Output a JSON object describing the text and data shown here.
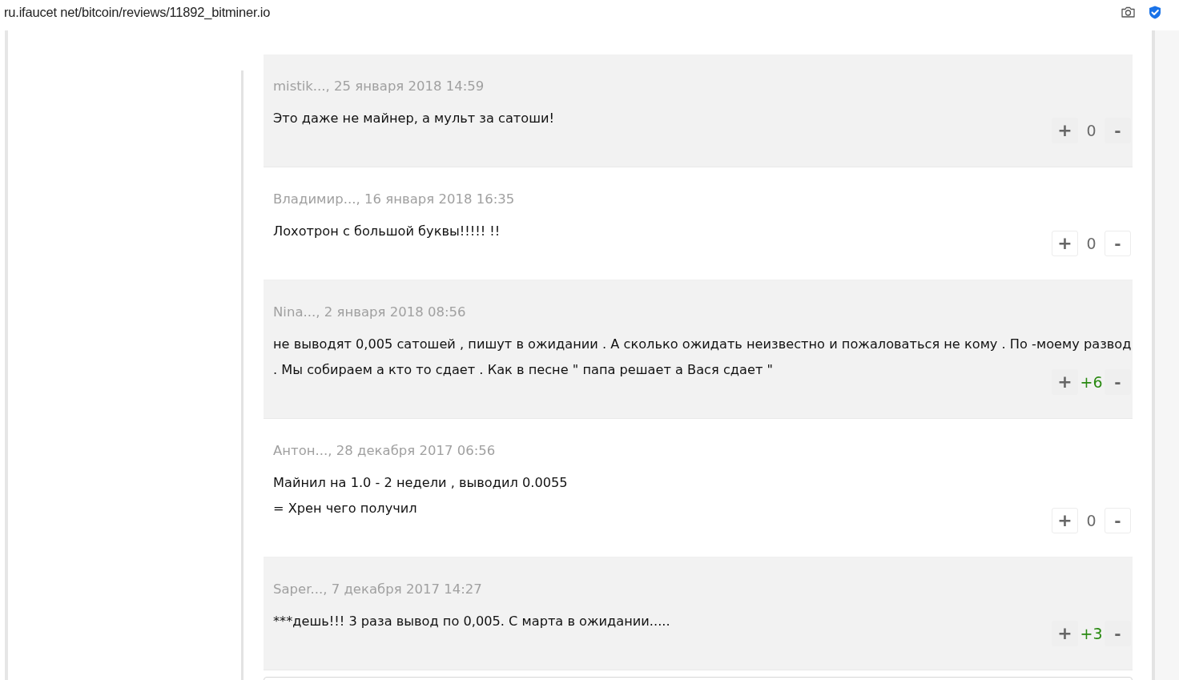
{
  "address_bar": {
    "url": "ru.ifaucet net/bitcoin/reviews/11892_bitminer.io"
  },
  "comments": [
    {
      "meta": "mistik..., 25 января 2018 14:59",
      "lines": [
        "Это даже не майнер, а мульт за сатоши!"
      ],
      "shaded": true,
      "votes": {
        "up": "+",
        "score": "0",
        "down": "-",
        "color": "#6a6a6a"
      }
    },
    {
      "meta": "Владимир..., 16 января 2018 16:35",
      "lines": [
        "Лохотрон с большой буквы!!!!! !!"
      ],
      "shaded": false,
      "votes": {
        "up": "+",
        "score": "0",
        "down": "-",
        "color": "#6a6a6a"
      }
    },
    {
      "meta": "Nina..., 2 января 2018 08:56",
      "lines": [
        "не выводят 0,005 сатошей , пишут в ожидании . А сколько ожидать неизвестно и пожаловаться не кому . По -моему развод",
        ". Мы собираем а кто то сдает . Как в песне \" папа решает а Вася сдает \""
      ],
      "shaded": true,
      "votes": {
        "up": "+",
        "score": "+6",
        "down": "-",
        "color": "#2a8a12"
      }
    },
    {
      "meta": "Антон..., 28 декабря 2017 06:56",
      "lines": [
        "Майнил на 1.0 - 2 недели , выводил 0.0055",
        "= Хрен чего получил"
      ],
      "shaded": false,
      "votes": {
        "up": "+",
        "score": "0",
        "down": "-",
        "color": "#6a6a6a"
      }
    },
    {
      "meta": "Saper..., 7 декабря 2017 14:27",
      "lines": [
        "***дешь!!! 3 раза вывод по 0,005. С марта в ожидании....."
      ],
      "shaded": true,
      "votes": {
        "up": "+",
        "score": "+3",
        "down": "-",
        "color": "#2a8a12"
      }
    }
  ]
}
